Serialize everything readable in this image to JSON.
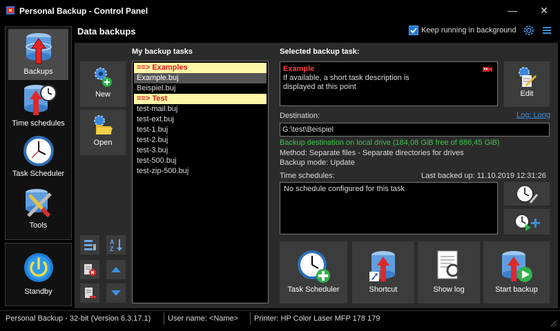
{
  "window": {
    "title": "Personal Backup - Control Panel",
    "minimize": "—",
    "close": "✕"
  },
  "sidebar": {
    "items": [
      {
        "label": "Backups",
        "icon": "backup-drive-icon"
      },
      {
        "label": "Time schedules",
        "icon": "schedule-drive-icon"
      },
      {
        "label": "Task Scheduler",
        "icon": "clock-icon"
      },
      {
        "label": "Tools",
        "icon": "tools-icon"
      }
    ],
    "standby": "Standby"
  },
  "header": {
    "title": "Data backups",
    "keep_running_label": "Keep running in background",
    "keep_running_checked": true
  },
  "toolbar": {
    "new_label": "New",
    "open_label": "Open"
  },
  "tasks": {
    "heading": "My backup tasks",
    "items": [
      {
        "text": "==> Examples",
        "kind": "group"
      },
      {
        "text": "Example.buj",
        "kind": "selected"
      },
      {
        "text": "Beispiel.buj",
        "kind": "item"
      },
      {
        "text": "==> Test",
        "kind": "group"
      },
      {
        "text": "test-mail.buj",
        "kind": "item"
      },
      {
        "text": "test-ext.buj",
        "kind": "item"
      },
      {
        "text": "test-1.buj",
        "kind": "item"
      },
      {
        "text": "test-2.buj",
        "kind": "item"
      },
      {
        "text": "test-3.buj",
        "kind": "item"
      },
      {
        "text": "test-500.buj",
        "kind": "item"
      },
      {
        "text": "test-zip-500.buj",
        "kind": "item"
      }
    ]
  },
  "selected": {
    "heading": "Selected backup task:",
    "name": "Example",
    "description": "If available, a short task description is displayed at this point",
    "edit_label": "Edit",
    "destination_label": "Destination:",
    "log_link": "Log: Long",
    "destination_value": "G:\\test\\Beispiel",
    "destination_status": "Backup destination on local drive (184,08 GiB free of 886,45 GiB)",
    "method": "Method: Separate files - Separate directories for drives",
    "mode": "Backup mode: Update",
    "time_schedules_label": "Time schedules:",
    "last_backed_up": "Last backed up: 11.10.2019 12:31:26",
    "schedule_text": "No schedule configured for this task"
  },
  "actions": {
    "task_scheduler": "Task Scheduler",
    "shortcut": "Shortcut",
    "show_log": "Show log",
    "start_backup": "Start backup"
  },
  "status": {
    "version": "Personal Backup - 32-bit (Version 6.3.17.1)",
    "user": "User name: <Name>",
    "printer": "Printer: HP Color Laser MFP 178 179"
  },
  "colors": {
    "accent": "#1e7ad6",
    "group_bg": "#fff7a8",
    "group_text": "#e01a1a",
    "ok_text": "#3ec44e",
    "link": "#3d8fe0"
  }
}
